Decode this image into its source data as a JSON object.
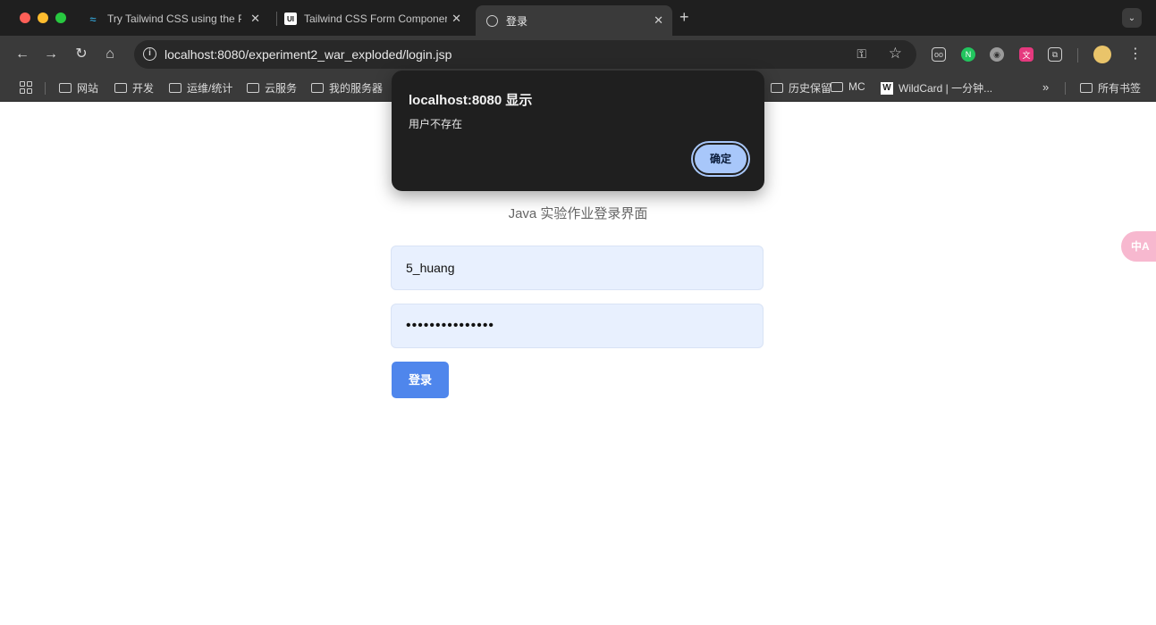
{
  "browser": {
    "tabs": [
      {
        "title": "Try Tailwind CSS using the Pl",
        "favicon": "tailwind-icon",
        "active": false
      },
      {
        "title": "Tailwind CSS Form Componer",
        "favicon": "ui-icon",
        "active": false
      },
      {
        "title": "登录",
        "favicon": "globe-icon",
        "active": true
      }
    ],
    "tab_close_glyph": "✕",
    "new_tab_glyph": "+",
    "tab_menu_glyph": "⌄",
    "url": "localhost:8080/experiment2_war_exploded/login.jsp",
    "bookmarks": [
      {
        "label": "网站"
      },
      {
        "label": "开发"
      },
      {
        "label": "运维/统计"
      },
      {
        "label": "云服务"
      },
      {
        "label": "我的服务器"
      },
      {
        "label": "历史保留"
      },
      {
        "label": "MC"
      },
      {
        "label": "WildCard | 一分钟..."
      }
    ],
    "bookmarks_more": "»",
    "all_bookmarks": "所有书签",
    "wildcard_fav": "W"
  },
  "page": {
    "subtitle": "Java 实验作业登录界面",
    "username_value": "5_huang",
    "password_masked": "•••••••••••••••",
    "login_label": "登录",
    "translate_badge": "中A"
  },
  "dialog": {
    "title": "localhost:8080 显示",
    "message": "用户不存在",
    "ok_label": "确定"
  },
  "colors": {
    "accent": "#4f86ec",
    "dialog_button": "#a8c7fa",
    "input_bg": "#e8f0fe"
  }
}
